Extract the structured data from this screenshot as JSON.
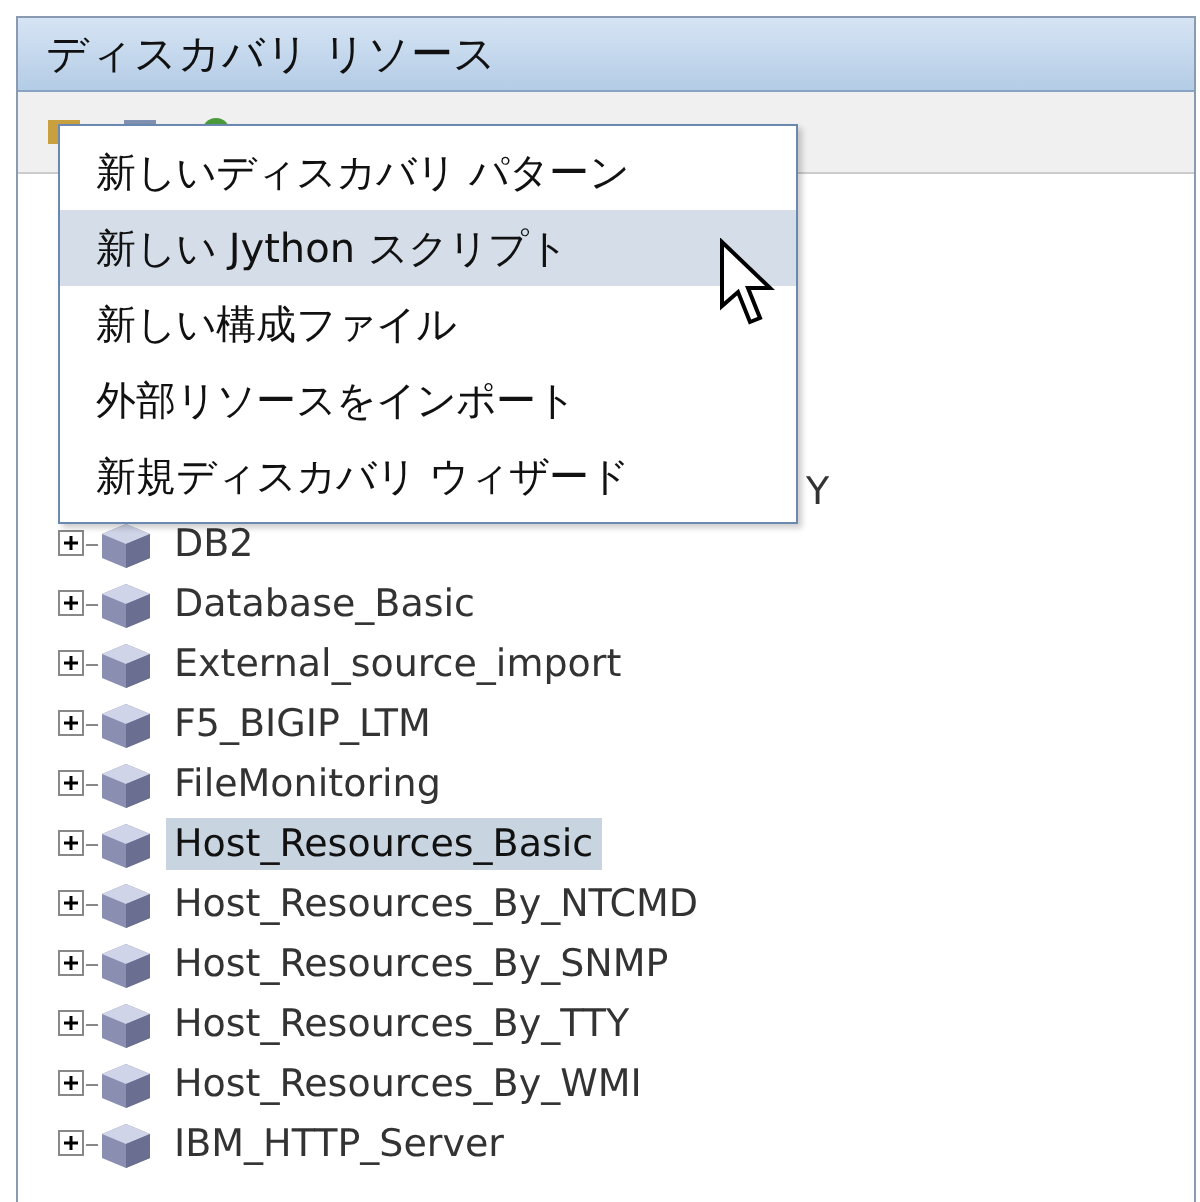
{
  "panel": {
    "title": "ディスカバリ リソース"
  },
  "context_menu": {
    "items": [
      {
        "label": "新しいディスカバリ パターン",
        "selected": false
      },
      {
        "label": "新しい Jython スクリプト",
        "selected": true
      },
      {
        "label": "新しい構成ファイル",
        "selected": false
      },
      {
        "label": "外部リソースをインポート",
        "selected": false
      },
      {
        "label": "新規ディスカバリ ウィザード",
        "selected": false
      }
    ]
  },
  "covered_tree_text": "Y",
  "tree": {
    "items": [
      {
        "label": "DB2",
        "selected": false,
        "expanded": false
      },
      {
        "label": "Database_Basic",
        "selected": false,
        "expanded": false
      },
      {
        "label": "External_source_import",
        "selected": false,
        "expanded": false
      },
      {
        "label": "F5_BIGIP_LTM",
        "selected": false,
        "expanded": false
      },
      {
        "label": "FileMonitoring",
        "selected": false,
        "expanded": false
      },
      {
        "label": "Host_Resources_Basic",
        "selected": true,
        "expanded": false
      },
      {
        "label": "Host_Resources_By_NTCMD",
        "selected": false,
        "expanded": false
      },
      {
        "label": "Host_Resources_By_SNMP",
        "selected": false,
        "expanded": false
      },
      {
        "label": "Host_Resources_By_TTY",
        "selected": false,
        "expanded": false
      },
      {
        "label": "Host_Resources_By_WMI",
        "selected": false,
        "expanded": false
      },
      {
        "label": "IBM_HTTP_Server",
        "selected": false,
        "expanded": false
      }
    ]
  }
}
